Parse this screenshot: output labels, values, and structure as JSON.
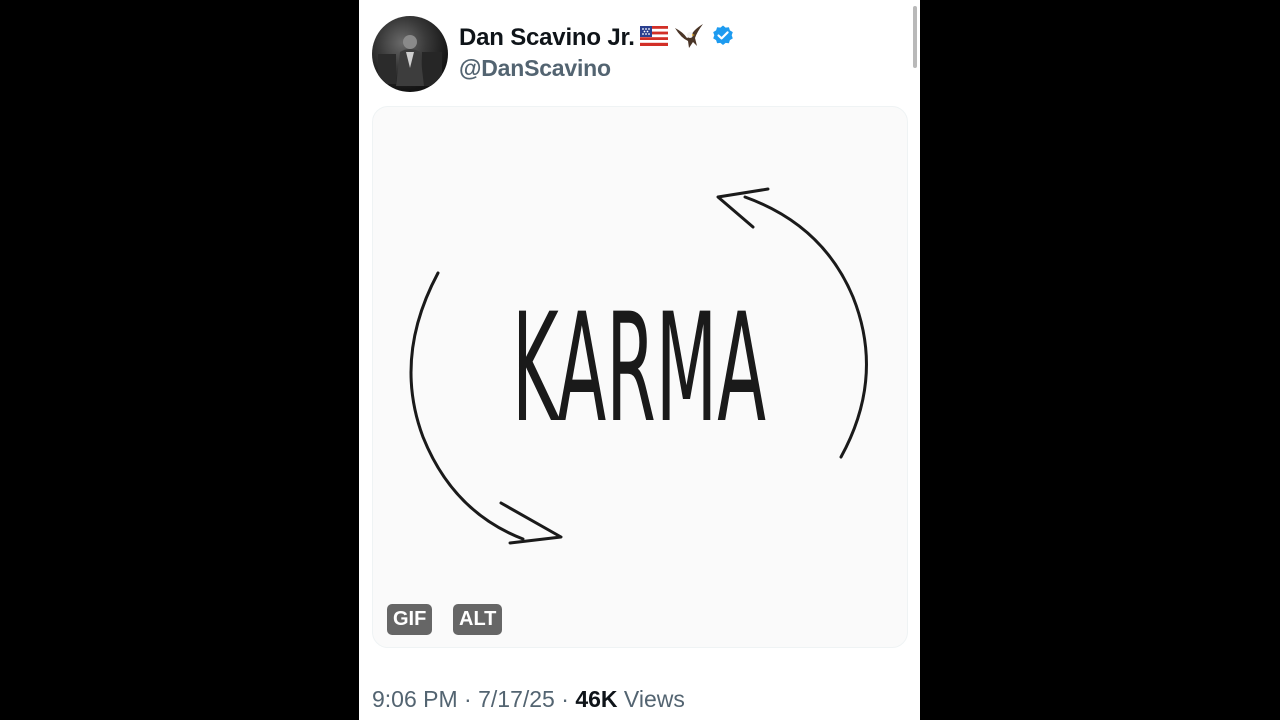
{
  "tweet": {
    "display_name": "Dan Scavino Jr.",
    "handle": "@DanScavino",
    "verified": true,
    "emoji_icons": [
      "us-flag-icon",
      "eagle-icon"
    ],
    "accent_color": "#1d9bf0"
  },
  "media": {
    "art_text": "KARMA",
    "badges": {
      "gif": "GIF",
      "alt": "ALT"
    }
  },
  "meta": {
    "time": "9:06 PM",
    "separator": "·",
    "date": "7/17/25",
    "views_count": "46K",
    "views_label": "Views"
  }
}
